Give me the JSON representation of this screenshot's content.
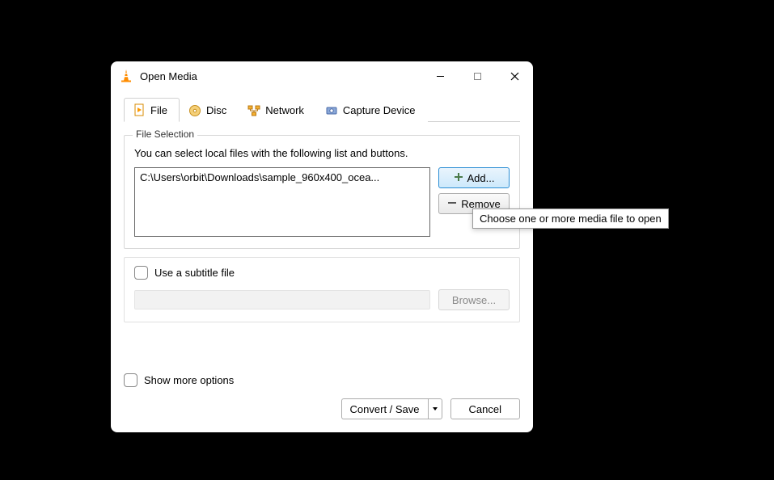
{
  "window": {
    "title": "Open Media"
  },
  "tabs": {
    "file": "File",
    "disc": "Disc",
    "network": "Network",
    "capture": "Capture Device"
  },
  "fileSelection": {
    "legend": "File Selection",
    "hint": "You can select local files with the following list and buttons.",
    "listItem": "C:\\Users\\orbit\\Downloads\\sample_960x400_ocea...",
    "addLabel": "Add...",
    "removeLabel": "Remove"
  },
  "subtitle": {
    "checkboxLabel": "Use a subtitle file",
    "browseLabel": "Browse..."
  },
  "footer": {
    "showMore": "Show more options",
    "convertSave": "Convert / Save",
    "cancel": "Cancel"
  },
  "tooltip": "Choose one or more media file to open"
}
